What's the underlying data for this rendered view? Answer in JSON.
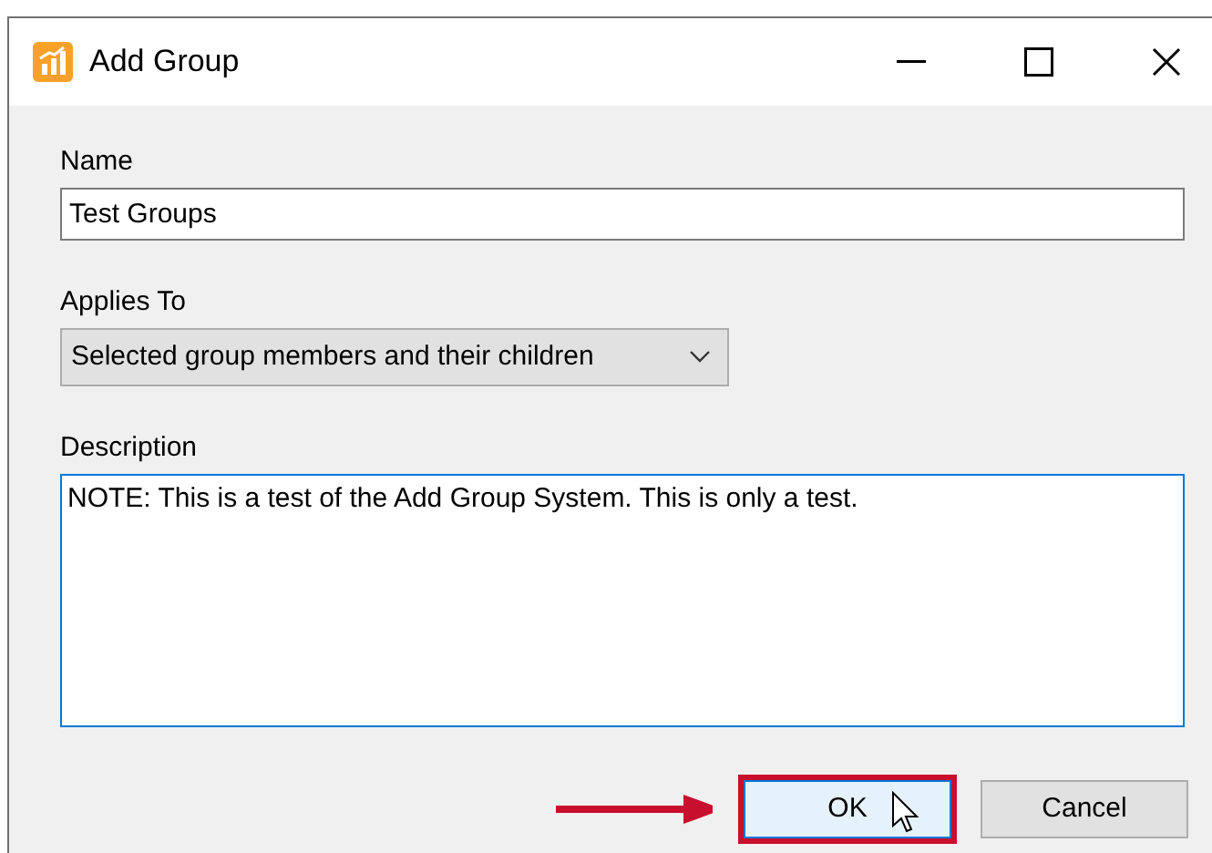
{
  "window": {
    "title": "Add Group"
  },
  "fields": [
    {
      "kind": "text",
      "label": "Name",
      "value": "Test Groups"
    },
    {
      "kind": "dropdown",
      "label": "Applies To",
      "value": "Selected group members and their children"
    },
    {
      "kind": "textarea",
      "label": "Description",
      "value": "NOTE: This is a test of the Add Group System. This is only a test.",
      "focused": true
    }
  ],
  "buttons": [
    {
      "label": "OK",
      "highlighted": true,
      "hovered": true
    },
    {
      "label": "Cancel",
      "highlighted": false,
      "hovered": false
    }
  ]
}
